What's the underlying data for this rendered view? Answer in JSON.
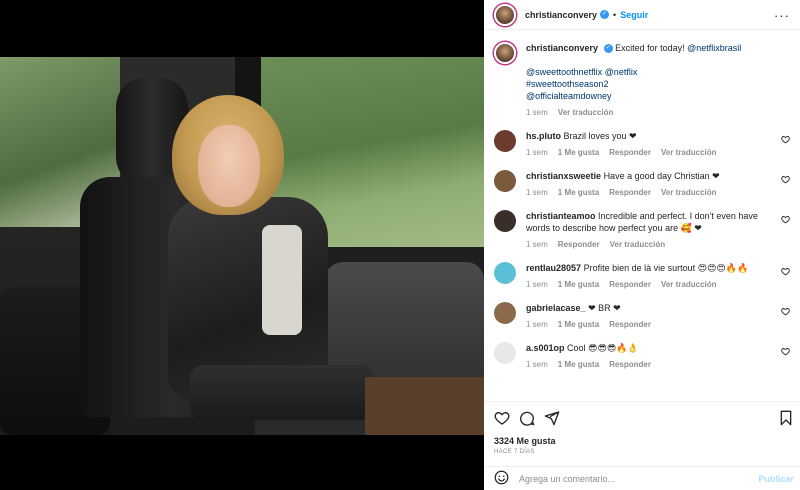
{
  "header": {
    "username": "christianconvery",
    "verified_mark": "✓",
    "separator": "•",
    "follow_label": "Seguir",
    "more_label": "···"
  },
  "caption": {
    "author": "christianconvery",
    "verified_mark": "✓",
    "text": "Excited for today!",
    "mention": "@netflixbrasil",
    "line2": "@sweettoothnetflix @netflix",
    "line3": "#sweettoothseason2",
    "line4": "@officialteamdowney",
    "time": "1 sem",
    "translate": "Ver traducción"
  },
  "comments": [
    {
      "author": "hs.pluto",
      "text": "Brazil loves you ❤",
      "time": "1 sem",
      "likes": "1 Me gusta",
      "reply": "Responder",
      "translate": "Ver traducción",
      "avatar_color": "#6b3b2f"
    },
    {
      "author": "christianxsweetie",
      "text": "Have a good day Christian ❤",
      "time": "1 sem",
      "likes": "1 Me gusta",
      "reply": "Responder",
      "translate": "Ver traducción",
      "avatar_color": "#7a5a3a"
    },
    {
      "author": "christianteamoo",
      "text": "Incredible and perfect. I don't even have words to describe how perfect you are 🥰 ❤",
      "time": "1 sem",
      "likes": "",
      "reply": "Responder",
      "translate": "Ver traducción",
      "avatar_color": "#3a2e28"
    },
    {
      "author": "rentlau28057",
      "text": "Profite bien de là vie surtout 😍😍😍🔥🔥",
      "time": "1 sem",
      "likes": "1 Me gusta",
      "reply": "Responder",
      "translate": "Ver traducción",
      "avatar_color": "#5bc0d6"
    },
    {
      "author": "gabrielacase_",
      "text": "❤ BR ❤",
      "time": "1 sem",
      "likes": "1 Me gusta",
      "reply": "Responder",
      "translate": "",
      "avatar_color": "#8a6a4a"
    },
    {
      "author": "a.s001op",
      "text": "Cool 😎😎😎🔥👌",
      "time": "1 sem",
      "likes": "1 Me gusta",
      "reply": "Responder",
      "translate": "",
      "avatar_color": "#e8e8e8"
    }
  ],
  "actions": {
    "like_icon": "heart-icon",
    "comment_icon": "comment-icon",
    "share_icon": "share-icon",
    "save_icon": "bookmark-icon"
  },
  "likes": "3324 Me gusta",
  "ago": "HACE 7 DÍAS",
  "add_comment": {
    "placeholder": "Agrega un comentario...",
    "post_label": "Publicar"
  },
  "colors": {
    "accent": "#0095f6",
    "verified": "#3897f0",
    "heart": "#ed4956"
  }
}
